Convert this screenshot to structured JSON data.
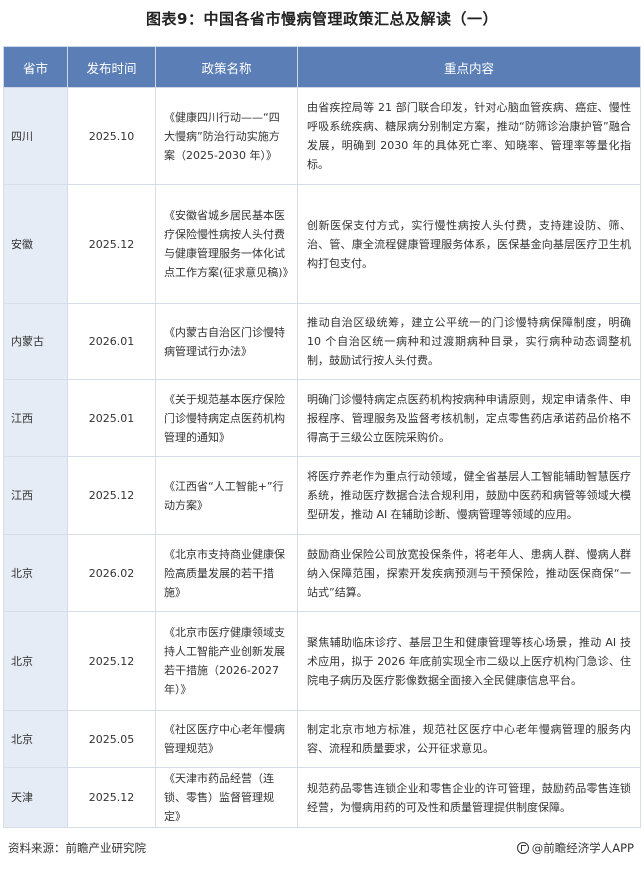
{
  "title": "图表9：中国各省市慢病管理政策汇总及解读（一）",
  "table": {
    "headers": [
      "省市",
      "发布时间",
      "政策名称",
      "重点内容"
    ],
    "rows": [
      {
        "province": "四川",
        "date": "2025.10",
        "policy": "《健康四川行动——“四大慢病”防治行动实施方案（2025-2030 年）》",
        "points": "由省疾控局等 21 部门联合印发，针对心脑血管疾病、癌症、慢性呼吸系统疾病、糖尿病分别制定方案，推动“防筛诊治康护管”融合发展，明确到 2030 年的具体死亡率、知晓率、管理率等量化指标。"
      },
      {
        "province": "安徽",
        "date": "2025.12",
        "policy": "《安徽省城乡居民基本医疗保险慢性病按人头付费与健康管理服务一体化试点工作方案(征求意见稿)》",
        "points": "创新医保支付方式，实行慢性病按人头付费，支持建设防、筛、治、管、康全流程健康管理服务体系，医保基金向基层医疗卫生机构打包支付。"
      },
      {
        "province": "内蒙古",
        "date": "2026.01",
        "policy": "《内蒙古自治区门诊慢特病管理试行办法》",
        "points": "推动自治区级统筹，建立公平统一的门诊慢特病保障制度，明确 10 个自治区统一病种和过渡期病种目录，实行病种动态调整机制，鼓励试行按人头付费。"
      },
      {
        "province": "江西",
        "date": "2025.01",
        "policy": "《关于规范基本医疗保险门诊慢特病定点医药机构管理的通知》",
        "points": "明确门诊慢特病定点医药机构按病种申请原则，规定申请条件、申报程序、管理服务及监督考核机制，定点零售药店承诺药品价格不得高于三级公立医院采购价。"
      },
      {
        "province": "江西",
        "date": "2025.12",
        "policy": "《江西省“人工智能+”行动方案》",
        "points": "将医疗养老作为重点行动领域，健全省基层人工智能辅助智慧医疗系统，推动医疗数据合法合规利用，鼓励中医药和病管等领域大模型研发，推动 AI 在辅助诊断、慢病管理等领域的应用。"
      },
      {
        "province": "北京",
        "date": "2026.02",
        "policy": "《北京市支持商业健康保险高质量发展的若干措施》",
        "points": "鼓励商业保险公司放宽投保条件，将老年人、患病人群、慢病人群纳入保障范围，探索开发疾病预测与干预保险，推动医保商保“一站式”结算。"
      },
      {
        "province": "北京",
        "date": "2025.12",
        "policy": "《北京市医疗健康领域支持人工智能产业创新发展若干措施（2026-2027 年）》",
        "points": "聚焦辅助临床诊疗、基层卫生和健康管理等核心场景，推动 AI 技术应用，拟于 2026 年底前实现全市二级以上医疗机构门急诊、住院电子病历及医疗影像数据全面接入全民健康信息平台。"
      },
      {
        "province": "北京",
        "date": "2025.05",
        "policy": "《社区医疗中心老年慢病管理规范》",
        "points": "制定北京市地方标准，规范社区医疗中心老年慢病管理的服务内容、流程和质量要求，公开征求意见。"
      },
      {
        "province": "天津",
        "date": "2025.12",
        "policy": "《天津市药品经营（连锁、零售）监督管理规定》",
        "points": "规范药品零售连锁企业和零售企业的许可管理，鼓励药品零售连锁经营，为慢病用药的可及性和质量管理提供制度保障。"
      }
    ]
  },
  "footer": {
    "source": "资料来源：前瞻产业研究院",
    "brand": "@前瞻经济学人APP"
  }
}
